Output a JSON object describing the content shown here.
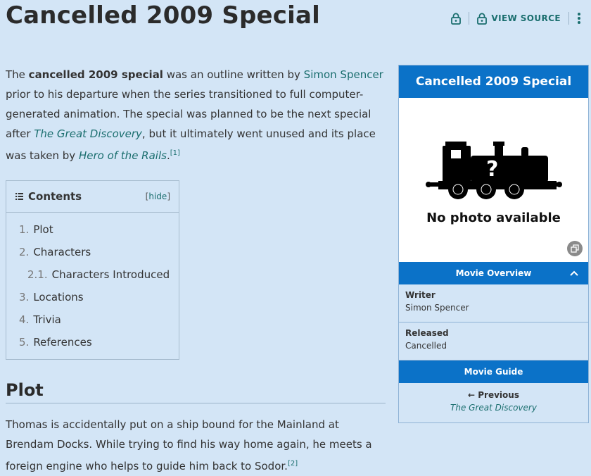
{
  "page": {
    "title": "Cancelled 2009 Special",
    "view_source": "VIEW SOURCE"
  },
  "intro": {
    "p1": "The ",
    "bold": "cancelled 2009 special",
    "p2": " was an outline written by ",
    "link1": "Simon Spencer",
    "p3": " prior to his departure when the series transitioned to full computer-generated animation. The special was planned to be the next special after ",
    "link2": "The Great Discovery",
    "p4": ", but it ultimately went unused and its place was taken by ",
    "link3": "Hero of the Rails",
    "p5": ".",
    "ref": "[1]"
  },
  "toc": {
    "title": "Contents",
    "hide_open": "[",
    "hide": "hide",
    "hide_close": "]",
    "items": [
      {
        "num": "1.",
        "label": "Plot"
      },
      {
        "num": "2.",
        "label": "Characters"
      },
      {
        "num": "2.1.",
        "label": "Characters Introduced"
      },
      {
        "num": "3.",
        "label": "Locations"
      },
      {
        "num": "4.",
        "label": "Trivia"
      },
      {
        "num": "5.",
        "label": "References"
      }
    ]
  },
  "plot": {
    "heading": "Plot",
    "text": "Thomas is accidentally put on a ship bound for the Mainland at Brendam Docks. While trying to find his way home again, he meets a foreign engine who helps to guide him back to Sodor.",
    "ref": "[2]"
  },
  "infobox": {
    "title": "Cancelled 2009 Special",
    "image_caption": "No photo available",
    "image_mark": "?",
    "section_overview": "Movie Overview",
    "writer_label": "Writer",
    "writer_value": "Simon Spencer",
    "released_label": "Released",
    "released_value": "Cancelled",
    "section_guide": "Movie Guide",
    "previous_label": "← Previous",
    "previous_title": "The Great Discovery"
  },
  "colors": {
    "background": "#d3e5f6",
    "accent": "#0b72c8",
    "link": "#1a6e6e"
  },
  "icons": [
    "lock-icon",
    "lock-icon",
    "more-vertical-icon",
    "list-icon",
    "expand-icon",
    "chevron-up-icon"
  ]
}
